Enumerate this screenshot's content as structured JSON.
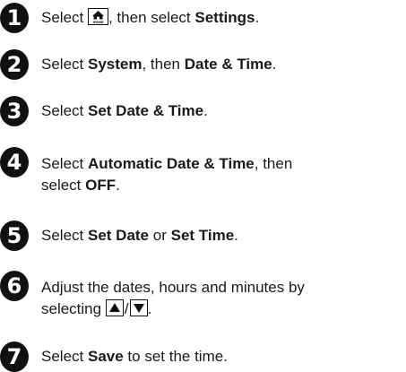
{
  "steps": [
    {
      "number": "1",
      "select": "Select",
      "after_icon": ", then select",
      "settings": "Settings",
      "period": "."
    },
    {
      "number": "2",
      "select": "Select",
      "system": "System",
      "then": ", then",
      "date_time": "Date & Time",
      "period": "."
    },
    {
      "number": "3",
      "select": "Select",
      "set_date_time": "Set Date & Time",
      "period": "."
    },
    {
      "number": "4",
      "select": "Select",
      "automatic": "Automatic Date & Time",
      "then": ", then",
      "select2": "select",
      "off": "OFF",
      "period": "."
    },
    {
      "number": "5",
      "select": "Select",
      "set_date": "Set Date",
      "or": "or",
      "set_time": "Set Time",
      "period": "."
    },
    {
      "number": "6",
      "line1": "Adjust the dates, hours and minutes by",
      "selecting": "selecting",
      "slash": "/",
      "period": "."
    },
    {
      "number": "7",
      "select": "Select",
      "save": "Save",
      "to_set": "to set the time",
      "period": "."
    }
  ],
  "icons": {
    "home": "home-icon",
    "home_label": "HOME",
    "up": "up-arrow-icon",
    "down": "down-arrow-icon"
  },
  "colors": {
    "text": "#1a1a1a",
    "badge": "#111111"
  }
}
